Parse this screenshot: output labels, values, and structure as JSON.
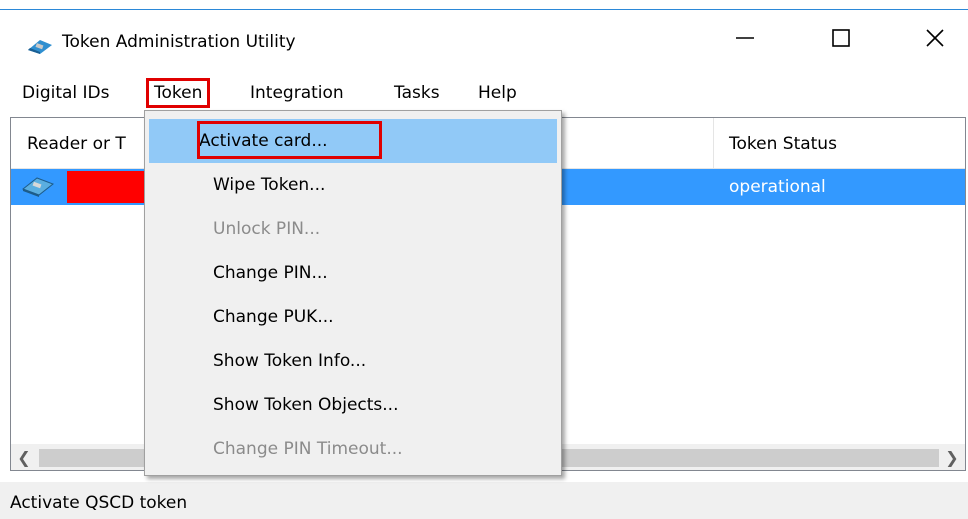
{
  "window": {
    "title": "Token Administration Utility",
    "controls": {
      "minimize_icon": "minimize-icon",
      "maximize_icon": "maximize-icon",
      "close_icon": "close-icon"
    }
  },
  "menubar": {
    "items": [
      "Digital IDs",
      "Token",
      "Integration",
      "Tasks",
      "Help"
    ],
    "active": "Token",
    "highlight_color": "#e00000"
  },
  "list": {
    "columns": [
      "Reader or T",
      "Token Status"
    ],
    "rows": [
      {
        "reader": "",
        "status": "operational",
        "selected": true
      }
    ],
    "selection_color": "#3399ff"
  },
  "token_menu": {
    "items": [
      {
        "label": "Activate card...",
        "enabled": true,
        "hovered": true
      },
      {
        "label": "Wipe Token...",
        "enabled": true
      },
      {
        "label": "Unlock PIN...",
        "enabled": false
      },
      {
        "label": "Change PIN...",
        "enabled": true
      },
      {
        "label": "Change PUK...",
        "enabled": true
      },
      {
        "label": "Show Token Info...",
        "enabled": true
      },
      {
        "label": "Show Token Objects...",
        "enabled": true
      },
      {
        "label": "Change PIN Timeout...",
        "enabled": false
      }
    ],
    "hover_color": "#91c9f7"
  },
  "statusbar": {
    "text": "Activate QSCD token"
  }
}
